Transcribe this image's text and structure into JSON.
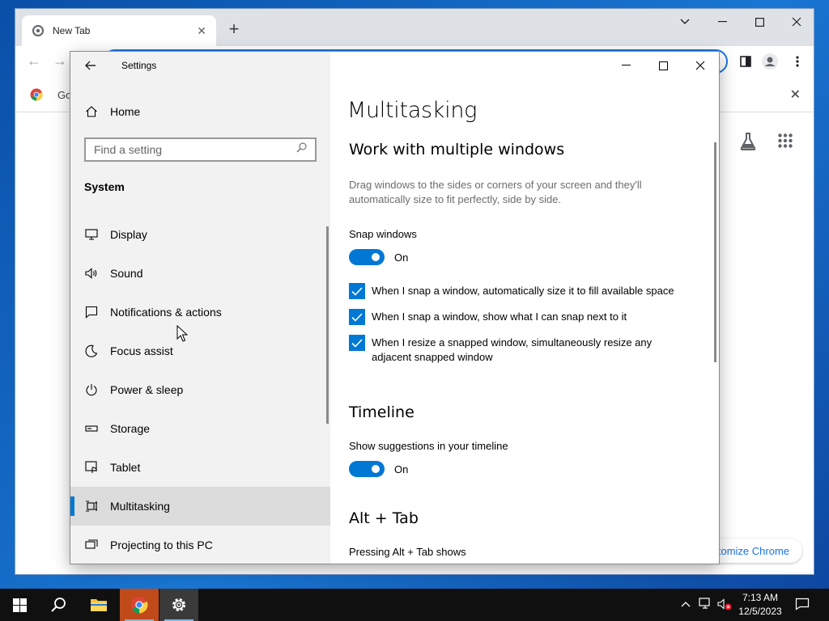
{
  "chrome": {
    "tab_title": "New Tab",
    "bookmark_label": "Go",
    "customize_label": "tomize Chrome"
  },
  "settings": {
    "app_title": "Settings",
    "home_label": "Home",
    "search_placeholder": "Find a setting",
    "section_label": "System",
    "nav_items": [
      {
        "label": "Display",
        "icon": "monitor-icon"
      },
      {
        "label": "Sound",
        "icon": "speaker-icon"
      },
      {
        "label": "Notifications & actions",
        "icon": "notification-icon"
      },
      {
        "label": "Focus assist",
        "icon": "moon-icon"
      },
      {
        "label": "Power & sleep",
        "icon": "power-icon"
      },
      {
        "label": "Storage",
        "icon": "storage-icon"
      },
      {
        "label": "Tablet",
        "icon": "tablet-icon"
      },
      {
        "label": "Multitasking",
        "icon": "multitasking-icon",
        "selected": true
      },
      {
        "label": "Projecting to this PC",
        "icon": "projector-icon"
      }
    ],
    "page": {
      "title": "Multitasking",
      "section1_title": "Work with multiple windows",
      "section1_desc": "Drag windows to the sides or corners of your screen and they'll automatically size to fit perfectly, side by side.",
      "snap_label": "Snap windows",
      "snap_state": "On",
      "checkboxes": [
        "When I snap a window, automatically size it to fill available space",
        "When I snap a window, show what I can snap next to it",
        "When I resize a snapped window, simultaneously resize any adjacent snapped window"
      ],
      "timeline_title": "Timeline",
      "timeline_label": "Show suggestions in your timeline",
      "timeline_state": "On",
      "alttab_title": "Alt + Tab",
      "alttab_label": "Pressing Alt + Tab shows"
    }
  },
  "taskbar": {
    "time": "7:13 AM",
    "date": "12/5/2023"
  },
  "colors": {
    "accent": "#0078d4",
    "chrome_accent": "#1a73e8"
  }
}
